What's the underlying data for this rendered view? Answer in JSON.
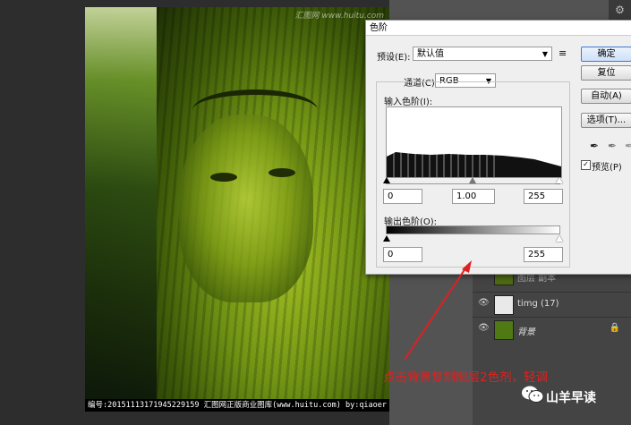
{
  "photo": {
    "watermark": "汇图网 www.huitu.com",
    "caption": "编号:20151113171945229159  汇图网正版商业图库(www.huitu.com) by:qiaoer"
  },
  "dialog": {
    "title": "色阶",
    "preset_label": "预设(E):",
    "preset_value": "默认值",
    "channel_label": "通道(C):",
    "channel_value": "RGB",
    "input_levels_label": "输入色阶(I):",
    "input_values": [
      "0",
      "1.00",
      "255"
    ],
    "output_levels_label": "输出色阶(O):",
    "output_values": [
      "0",
      "255"
    ],
    "buttons": {
      "ok": "确定",
      "reset": "复位",
      "auto": "自动(A)",
      "options": "选项(T)..."
    },
    "preview_label": "预览(P)",
    "preview_checked": true
  },
  "layers": [
    {
      "name": "图层 副本",
      "icon": "eye-icon"
    },
    {
      "name": "timg (17)",
      "icon": "eye-icon"
    },
    {
      "name": "背景",
      "icon": "eye-icon",
      "locked": true
    }
  ],
  "annotation": "点击背景复制图层2色剂，轻调",
  "brand": "山羊早读",
  "colors": {
    "annotation_red": "#e02020",
    "dialog_bg": "#efefef",
    "ps_panel": "#535353",
    "primary_button_border": "#3a7bd5"
  }
}
